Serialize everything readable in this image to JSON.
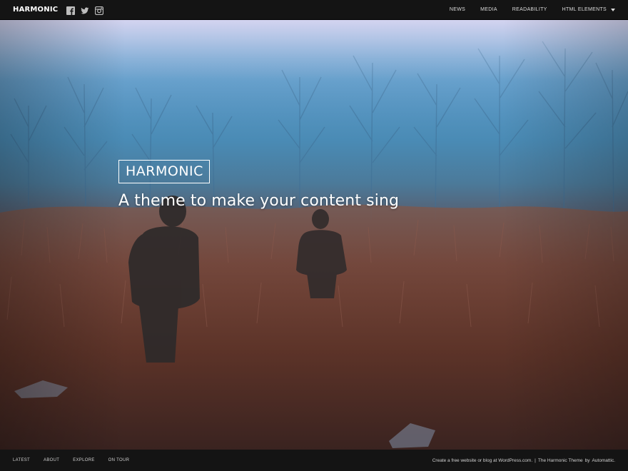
{
  "site": {
    "name": "HARMONIC"
  },
  "social": [
    {
      "icon": "facebook-icon"
    },
    {
      "icon": "twitter-icon"
    },
    {
      "icon": "instagram-icon"
    }
  ],
  "nav": {
    "items": [
      {
        "label": "NEWS"
      },
      {
        "label": "MEDIA"
      },
      {
        "label": "READABILITY"
      },
      {
        "label": "HTML ELEMENTS",
        "has_dropdown": true
      }
    ]
  },
  "hero": {
    "title": "HARMONIC",
    "tagline": "A theme to make your content sing"
  },
  "footer": {
    "nav": [
      {
        "label": "LATEST"
      },
      {
        "label": "ABOUT"
      },
      {
        "label": "EXPLORE"
      },
      {
        "label": "ON TOUR"
      }
    ],
    "credit_link": "Create a free website or blog at WordPress.com.",
    "separator": "|",
    "theme_text": "The Harmonic Theme",
    "by_text": "by",
    "author_link": "Automattic."
  },
  "colors": {
    "bar_background": "#141414",
    "text": "#ffffff",
    "nav_text": "#dcdcdc"
  }
}
